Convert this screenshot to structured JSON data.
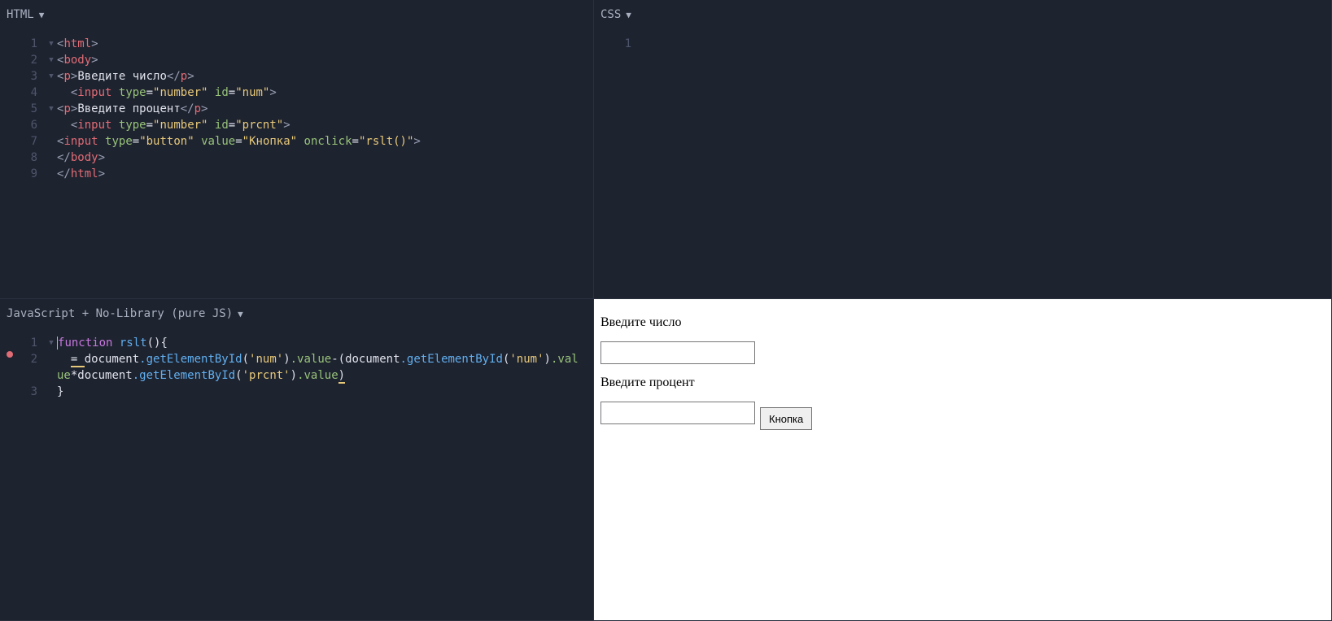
{
  "panes": {
    "html": {
      "title": "HTML"
    },
    "css": {
      "title": "CSS"
    },
    "js": {
      "title": "JavaScript + No-Library (pure JS)"
    }
  },
  "html_code": {
    "lines": [
      "1",
      "2",
      "3",
      "4",
      "5",
      "6",
      "7",
      "8",
      "9"
    ],
    "l1": {
      "open": "<",
      "tag": "html",
      "close": ">"
    },
    "l2": {
      "open": "<",
      "tag": "body",
      "close": ">"
    },
    "l3": {
      "open": "<",
      "tag_open": "p",
      "text": "Введите число",
      "tag_close": "p",
      "close": ">"
    },
    "l4": {
      "open": "  <",
      "tag": "input",
      "attr1": "type",
      "val1": "\"number\"",
      "attr2": "id",
      "val2": "\"num\"",
      "close": ">"
    },
    "l5": {
      "open": "<",
      "tag_open": "p",
      "text": "Введите процент",
      "tag_close": "p",
      "close": ">"
    },
    "l6": {
      "open": "  <",
      "tag": "input",
      "attr1": "type",
      "val1": "\"number\"",
      "attr2": "id",
      "val2": "\"prcnt\"",
      "close": ">"
    },
    "l7": {
      "open": "<",
      "tag": "input",
      "attr1": "type",
      "val1": "\"button\"",
      "attr2": "value",
      "val2": "\"Кнопка\"",
      "attr3": "onclick",
      "val3": "\"rslt()\"",
      "close": ">"
    },
    "l8": {
      "open": "</",
      "tag": "body",
      "close": ">"
    },
    "l9": {
      "open": "</",
      "tag": "html",
      "close": ">"
    }
  },
  "css_code": {
    "lines": [
      "1"
    ]
  },
  "js_code": {
    "lines": [
      "1",
      "2",
      "3"
    ],
    "l1": {
      "kw": "function",
      "name": " rslt",
      "paren": "(){",
      "f": "f"
    },
    "l2_a": "  ",
    "l2_eq": "= ",
    "l2_doc1": "document",
    "l2_get1": ".getElementById",
    "l2_arg1": "('num')",
    "l2_val1": ".value",
    "l2_minus": "-(",
    "l2_doc2": "document",
    "l2_get2": ".getElementById",
    "l2_arg2": "('num')",
    "l2_val2": ".val",
    "l2w_ue": "ue",
    "l2w_star": "*",
    "l2w_doc": "document",
    "l2w_get": ".getElementById",
    "l2w_arg": "('prcnt')",
    "l2w_val": ".value",
    "l2w_close": ")",
    "l3": "}"
  },
  "output": {
    "p1": "Введите число",
    "p2": "Введите процент",
    "button": "Кнопка"
  }
}
